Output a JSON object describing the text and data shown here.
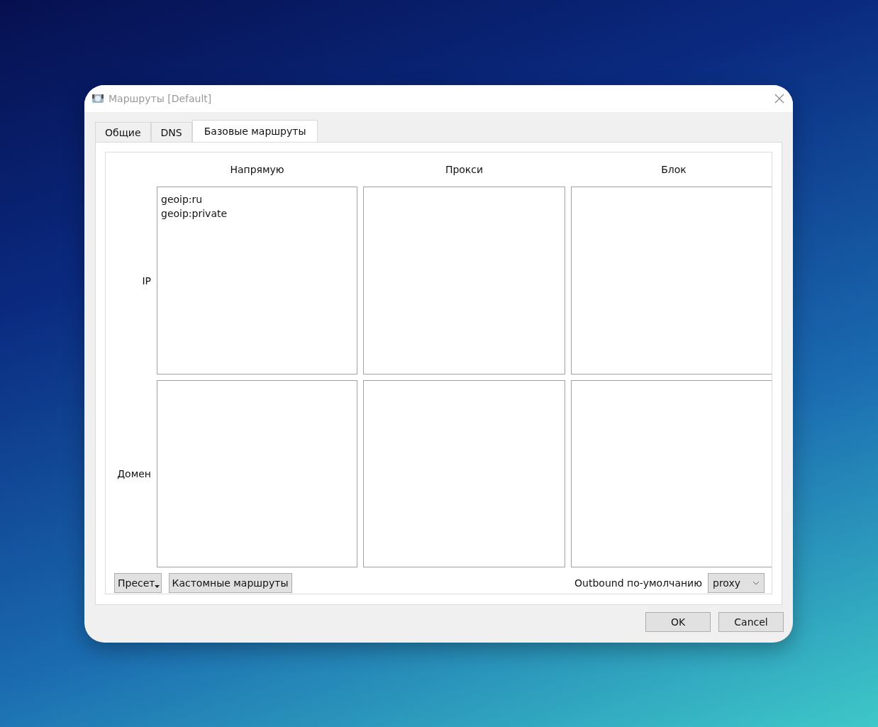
{
  "window": {
    "title": "Маршруты [Default]"
  },
  "tabs": [
    {
      "label": "Общие",
      "selected": false
    },
    {
      "label": "DNS",
      "selected": false
    },
    {
      "label": "Базовые маршруты",
      "selected": true
    }
  ],
  "columns": [
    "Напрямую",
    "Прокси",
    "Блок"
  ],
  "rows": [
    {
      "label": "IP",
      "cells": [
        {
          "lines": [
            "geoip:ru",
            "geoip:private"
          ]
        }
      ]
    },
    {
      "label": "Домен",
      "cells": []
    }
  ],
  "preset_button": "Пресет",
  "custom_routes_button": "Кастомные маршруты",
  "default_outbound": {
    "label": "Outbound по-умолчанию",
    "value": "proxy"
  },
  "buttons": [
    "OK",
    "Cancel"
  ]
}
